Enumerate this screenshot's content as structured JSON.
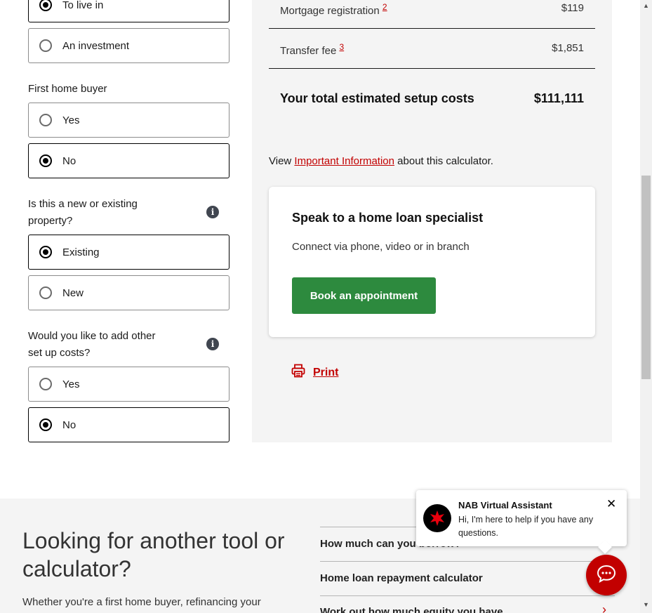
{
  "form": {
    "purpose": {
      "options": [
        {
          "label": "To live in",
          "selected": true
        },
        {
          "label": "An investment",
          "selected": false
        }
      ]
    },
    "first_home": {
      "question": "First home buyer",
      "options": [
        {
          "label": "Yes",
          "selected": false
        },
        {
          "label": "No",
          "selected": true
        }
      ]
    },
    "property_type": {
      "question": "Is this a new or existing property?",
      "options": [
        {
          "label": "Existing",
          "selected": true
        },
        {
          "label": "New",
          "selected": false
        }
      ]
    },
    "other_costs": {
      "question": "Would you like to add other set up costs?",
      "options": [
        {
          "label": "Yes",
          "selected": false
        },
        {
          "label": "No",
          "selected": true
        }
      ]
    },
    "info_icon": "i"
  },
  "summary": {
    "rows": [
      {
        "label": "Mortgage registration",
        "footnote": "2",
        "value": "$119"
      },
      {
        "label": "Transfer fee",
        "footnote": "3",
        "value": "$1,851"
      }
    ],
    "total_label": "Your total estimated setup costs",
    "total_value": "$111,111",
    "info_prefix": "View",
    "info_link": "Important Information",
    "info_suffix": "about this calculator."
  },
  "specialist": {
    "title": "Speak to a home loan specialist",
    "subtitle": "Connect via phone, video or in branch",
    "button": "Book an appointment"
  },
  "print": {
    "label": "Print",
    "icon": "printer-icon"
  },
  "tools": {
    "title": "Looking for another tool or calculator?",
    "description": "Whether you're a first home buyer, refinancing your",
    "links": [
      {
        "label": "How much can you borrow?"
      },
      {
        "label": "Home loan repayment calculator"
      },
      {
        "label": "Work out how much equity you have"
      }
    ]
  },
  "chat": {
    "name": "NAB Virtual Assistant",
    "message": "Hi, I'm here to help if you have any questions.",
    "close": "✕"
  },
  "colors": {
    "accent": "#c20000",
    "button_green": "#2d8a3e",
    "panel_bg": "#f4f4f4"
  }
}
